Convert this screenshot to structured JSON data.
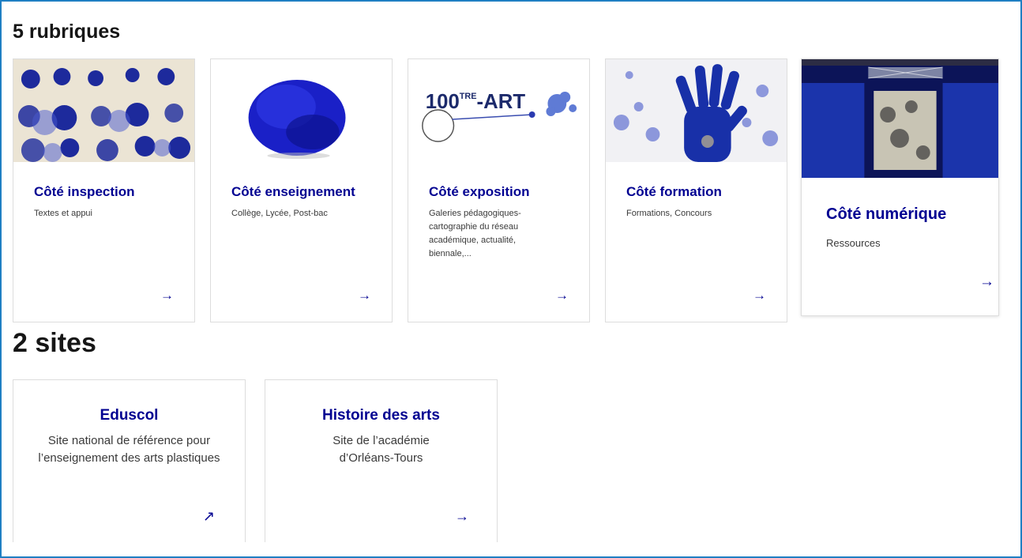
{
  "rubriques": {
    "heading": "5 rubriques",
    "cards": [
      {
        "title": "Côté inspection",
        "description": "Textes et appui",
        "arrow": "→"
      },
      {
        "title": "Côté enseignement",
        "description": "Collège, Lycée, Post-bac",
        "arrow": "→"
      },
      {
        "title": "Côté exposition",
        "description": "Galeries pédagogiques-cartographie du réseau académique, actualité, biennale,...",
        "arrow": "→",
        "image_text": "100",
        "image_text_sup": "TRE",
        "image_text_tail": "-ART"
      },
      {
        "title": "Côté formation",
        "description": "Formations, Concours",
        "arrow": "→"
      },
      {
        "title": "Côté numérique",
        "description": "Ressources",
        "arrow": "→"
      }
    ]
  },
  "sites": {
    "heading": "2 sites",
    "cards": [
      {
        "title": "Eduscol",
        "description": "Site national de référence pour l’enseignement des arts plastiques",
        "icon": "external-link-icon",
        "icon_glyph": "↗"
      },
      {
        "title": "Histoire des arts",
        "description": "Site de l’académie d’Orléans-Tours",
        "icon": "arrow-right-icon",
        "icon_glyph": "→"
      }
    ]
  },
  "colors": {
    "accent": "#000091",
    "frame": "#1f7fc3",
    "card_border": "#dddddd"
  }
}
